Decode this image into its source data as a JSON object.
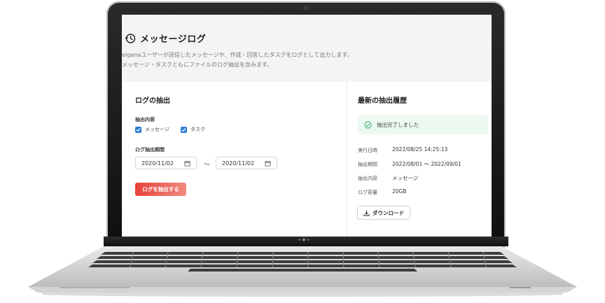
{
  "header": {
    "title": "メッセージログ",
    "description_line1": "elganaユーザーが送信したメッセージや、作成・回答したタスクをログとして出力します。",
    "description_line2": "メッセージ・タスクともにファイルのログ抽出を含みます。"
  },
  "extract_panel": {
    "heading": "ログの抽出",
    "content_label": "抽出内容",
    "options": [
      {
        "label": "メッセージ",
        "checked": true
      },
      {
        "label": "タスク",
        "checked": true
      }
    ],
    "period_label": "ログ抽出期間",
    "date_from": "2020/11/02",
    "date_separator": "〜",
    "date_to": "2020/11/02",
    "submit_label": "ログを抽出する"
  },
  "history_panel": {
    "heading": "最新の抽出履歴",
    "status": "抽出完了しました",
    "rows": [
      {
        "key": "実行日時",
        "value": "2022/08/25 14:25:13"
      },
      {
        "key": "抽出期間",
        "value": "2022/08/01 〜 2022/09/01"
      },
      {
        "key": "抽出内容",
        "value": "メッセージ"
      },
      {
        "key": "ログ容量",
        "value": "20GB"
      }
    ],
    "download_label": "ダウンロード"
  },
  "colors": {
    "accent_red": "#e8423a",
    "checkbox_blue": "#2f7ed8",
    "success_green": "#3cb371",
    "success_bg": "#edf8f1"
  }
}
